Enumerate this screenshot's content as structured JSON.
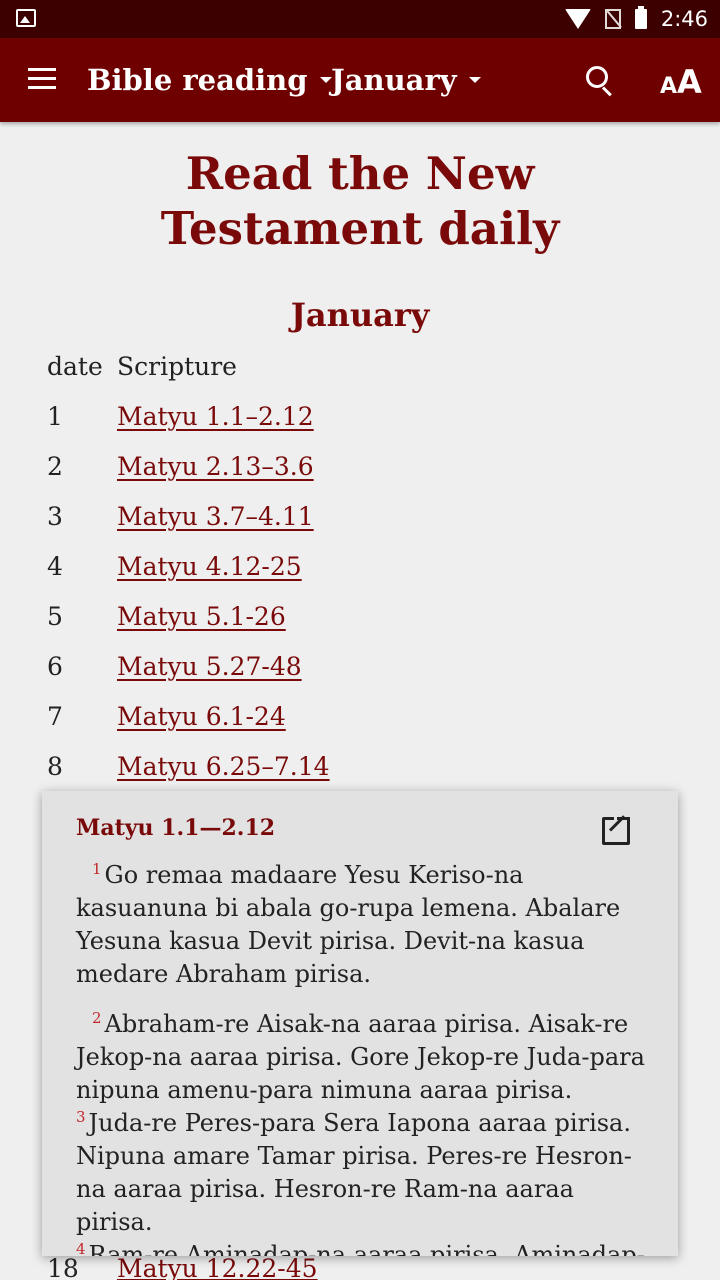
{
  "status_bar": {
    "time": "2:46"
  },
  "app_bar": {
    "book_label": "Bible reading",
    "month_label": "January"
  },
  "page": {
    "title": "Read the New Testament daily",
    "month_heading": "January",
    "table": {
      "headers": {
        "date": "date",
        "scripture": "Scripture"
      },
      "rows": [
        {
          "date": "1",
          "ref": "Matyu 1.1–2.12"
        },
        {
          "date": "2",
          "ref": "Matyu 2.13–3.6"
        },
        {
          "date": "3",
          "ref": "Matyu 3.7–4.11"
        },
        {
          "date": "4",
          "ref": "Matyu 4.12-25"
        },
        {
          "date": "5",
          "ref": "Matyu 5.1-26"
        },
        {
          "date": "6",
          "ref": "Matyu 5.27-48"
        },
        {
          "date": "7",
          "ref": "Matyu 6.1-24"
        },
        {
          "date": "8",
          "ref": "Matyu 6.25–7.14"
        }
      ],
      "partial_row": {
        "date": "18",
        "ref": "Matyu 12.22-45"
      }
    }
  },
  "popup": {
    "title": "Matyu 1.1—2.12",
    "verses": [
      {
        "num": "1",
        "text": "Go remaa madaare Yesu Keriso-na kasuanuna bi abala go-rupa lemena. Abalare Yesuna kasua Devit pirisa. Devit-na kasua medare Abraham pirisa."
      },
      {
        "num": "2",
        "text": "Abraham-re Aisak-na aaraa pirisa. Aisak-re Jekop-na aaraa pirisa. Gore Jekop-re Juda-para nipuna amenu-para nimuna aaraa pirisa."
      },
      {
        "num": "3",
        "text": "Juda-re Peres-para Sera Iapona aaraa pirisa. Nipuna amare Tamar pirisa. Peres-re Hesron-na aaraa pirisa. Hesron-re Ram-na aaraa pirisa."
      },
      {
        "num": "4",
        "text": "Ram-re Aminadap-na aaraa pirisa. Aminadap-"
      }
    ]
  }
}
